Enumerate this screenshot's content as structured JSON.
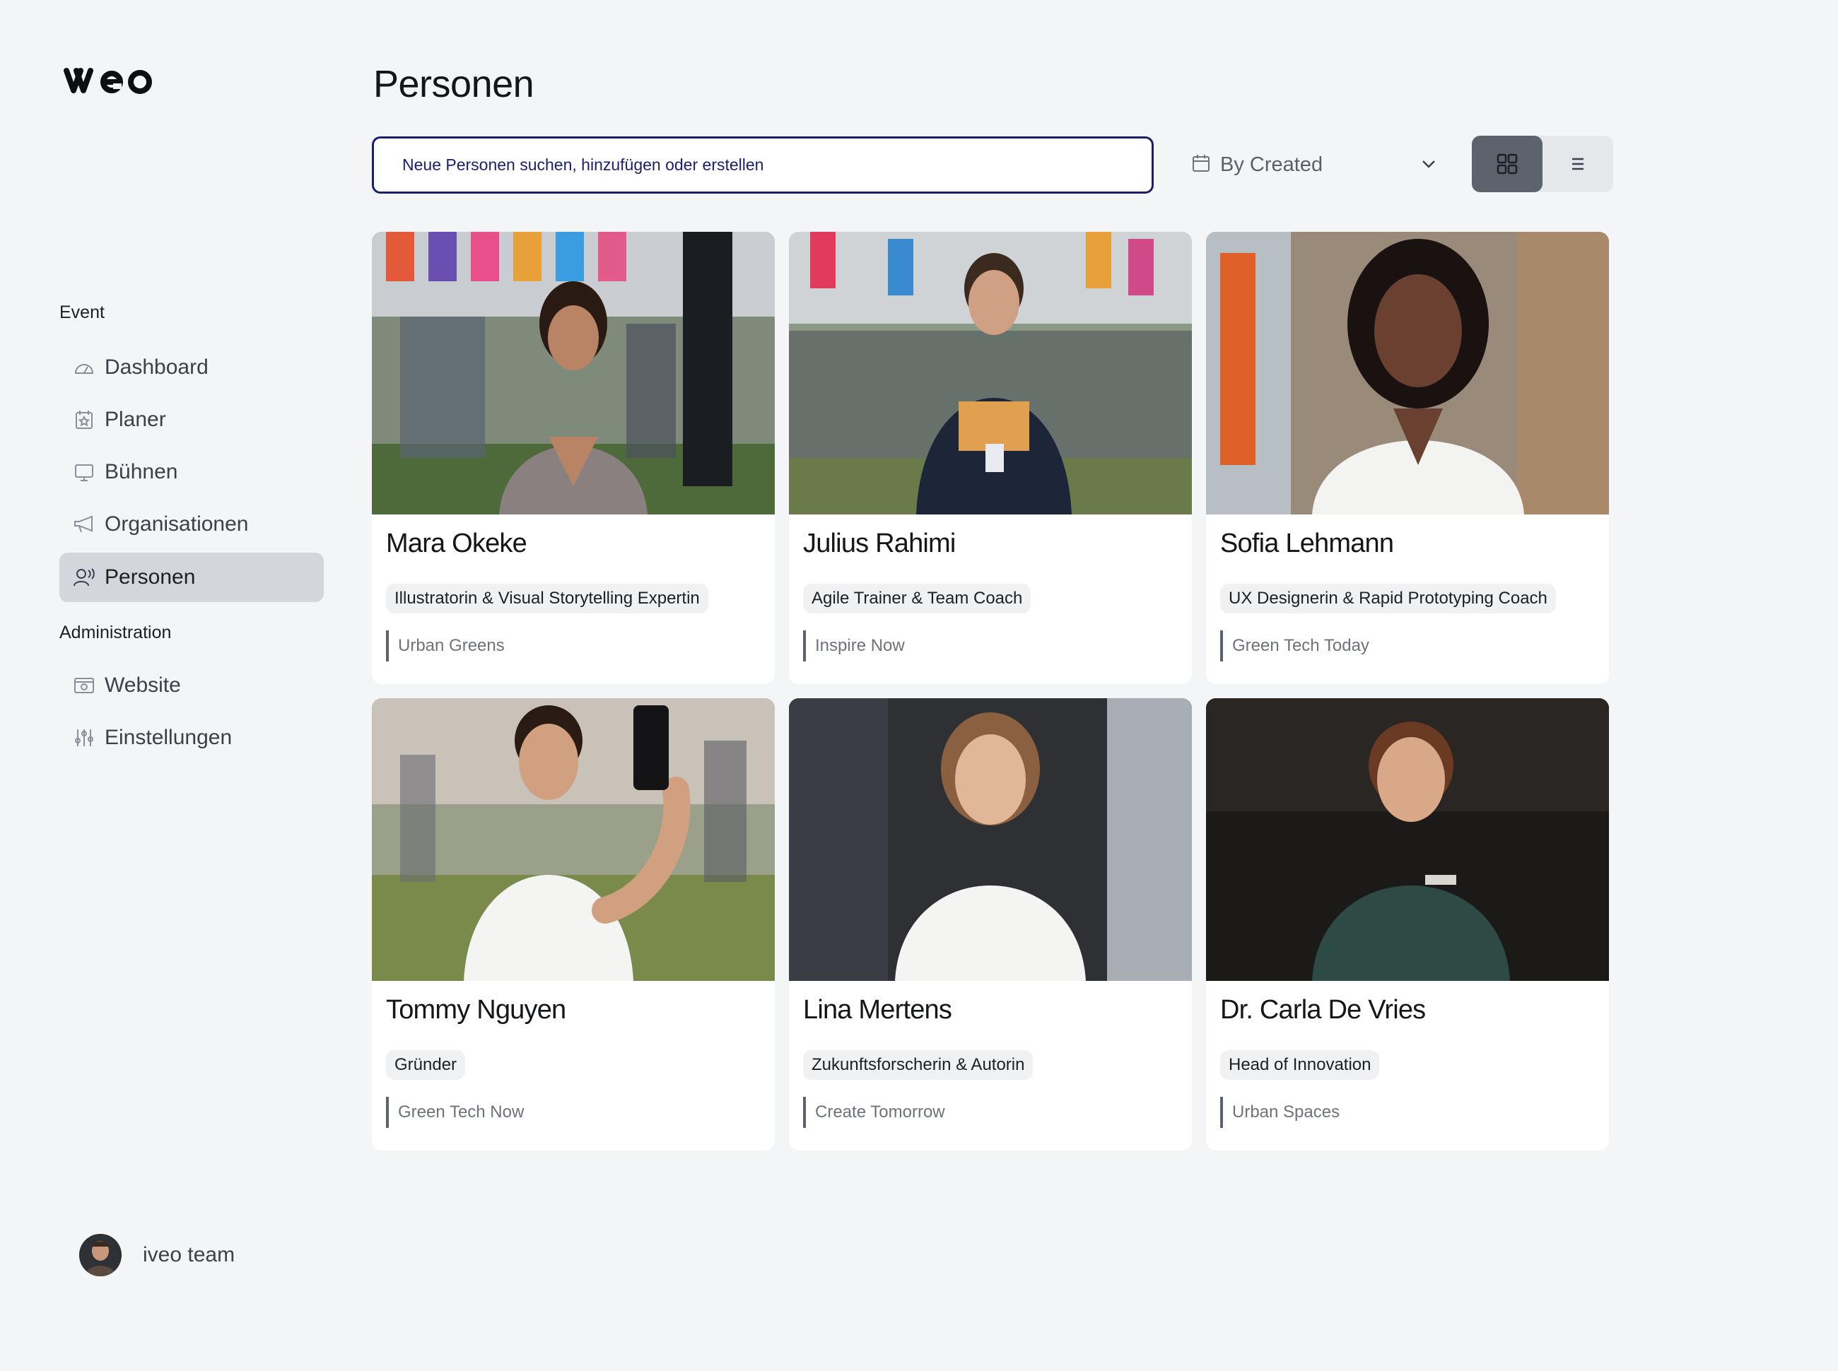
{
  "app": {
    "logo_text": "iveo"
  },
  "page": {
    "title": "Personen"
  },
  "sidebar": {
    "sections": [
      {
        "label": "Event",
        "items": [
          {
            "label": "Dashboard",
            "icon": "dashboard-icon"
          },
          {
            "label": "Planer",
            "icon": "calendar-star-icon"
          },
          {
            "label": "Bühnen",
            "icon": "monitor-icon"
          },
          {
            "label": "Organisationen",
            "icon": "megaphone-icon"
          },
          {
            "label": "Personen",
            "icon": "people-icon",
            "active": true
          }
        ]
      },
      {
        "label": "Administration",
        "items": [
          {
            "label": "Website",
            "icon": "browser-icon"
          },
          {
            "label": "Einstellungen",
            "icon": "sliders-icon"
          }
        ]
      }
    ]
  },
  "search": {
    "placeholder": "Neue Personen suchen, hinzufügen oder erstellen",
    "value": ""
  },
  "sort": {
    "label": "By Created",
    "icon": "calendar-icon"
  },
  "view_toggle": {
    "active": "grid",
    "options": [
      "grid",
      "list"
    ]
  },
  "people": [
    {
      "name": "Mara Okeke",
      "role": "Illustratorin & Visual Storytelling Expertin",
      "organization": "Urban Greens"
    },
    {
      "name": "Julius Rahimi",
      "role": "Agile Trainer & Team Coach",
      "organization": "Inspire Now"
    },
    {
      "name": "Sofia Lehmann",
      "role": "UX Designerin & Rapid Prototyping Coach",
      "organization": "Green Tech Today"
    },
    {
      "name": "Tommy Nguyen",
      "role": "Gründer",
      "organization": "Green Tech Now"
    },
    {
      "name": "Lina Mertens",
      "role": "Zukunftsforscherin & Autorin",
      "organization": "Create Tomorrow"
    },
    {
      "name": "Dr. Carla De Vries",
      "role": "Head of Innovation",
      "organization": "Urban Spaces"
    }
  ],
  "user": {
    "name": "iveo team"
  },
  "colors": {
    "accent": "#1c1f6e",
    "active_nav": "#d3d6db",
    "toggle_active": "#5d636c",
    "background": "#f4f5f7"
  }
}
